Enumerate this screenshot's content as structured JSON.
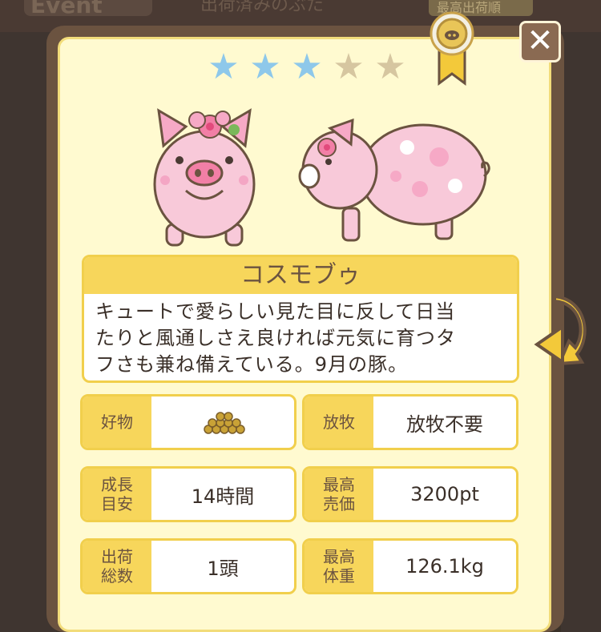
{
  "background": {
    "event_label": "Event",
    "title_fragment": "出荷済みのぶた",
    "tab_fragment": "最高出荷順"
  },
  "card": {
    "rarity_stars": 3,
    "rarity_max": 5,
    "star_on_color": "#8ec8ea",
    "star_off_color": "#d6c6a0",
    "name": "コスモブゥ",
    "description_lines": [
      "キュートで愛らしい見た目に反して日当",
      "たりと風通しさえ良ければ元気に育つタ",
      "フさも兼ね備えている。9月の豚。"
    ],
    "close_label": "✕"
  },
  "info": {
    "favorite": {
      "label": "好物",
      "icon": "grain-pile-icon"
    },
    "grazing": {
      "label": "放牧",
      "value": "放牧不要"
    },
    "growth": {
      "label_line1": "成長",
      "label_line2": "目安",
      "value": "14時間"
    },
    "max_price": {
      "label_line1": "最高",
      "label_line2": "売価",
      "value": "3200pt"
    },
    "shipped": {
      "label_line1": "出荷",
      "label_line2": "総数",
      "value": "1頭"
    },
    "max_weight": {
      "label_line1": "最高",
      "label_line2": "体重",
      "value": "126.1kg"
    }
  }
}
